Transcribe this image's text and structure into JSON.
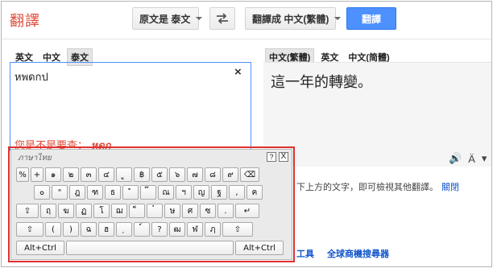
{
  "header": {
    "logo": "翻譯",
    "source_select": "原文是 泰文",
    "target_select": "翻譯成 中文(繁體)",
    "translate_button": "翻譯"
  },
  "source": {
    "tabs": [
      "英文",
      "中文",
      "泰文"
    ],
    "active_tab": 2,
    "text": "หพดกป",
    "clear": "×",
    "did_you_mean_prefix": "您是不是要查：",
    "did_you_mean_suggestion": "หดก"
  },
  "target": {
    "tabs": [
      "中文(繁體)",
      "英文",
      "中文(简體)"
    ],
    "active_tab": 0,
    "text": "這一年的轉變。",
    "speaker": "🔊",
    "phonetic": "Ä",
    "menu": "▾"
  },
  "hint": {
    "text": "下上方的文字，即可檢視其他翻譯。",
    "link": "關閉"
  },
  "footer": {
    "tools": "工具",
    "search_engine": "全球商機搜尋器"
  },
  "keyboard": {
    "title": "ภาษาไทย",
    "help": "?",
    "close": "X",
    "rows": [
      [
        "%",
        "+",
        "๑",
        "๒",
        "๓",
        "๔",
        "ู",
        "฿",
        "๕",
        "๖",
        "๗",
        "๘",
        "๙",
        "⌫"
      ],
      [
        "๐",
        "\"",
        "ฎ",
        "ฑ",
        "ธ",
        "ํ",
        "๊",
        "ณ",
        "ฯ",
        "ญ",
        "ฐ",
        ",",
        "ฅ"
      ],
      [
        "⇪",
        "ฤ",
        "ฆ",
        "ฏ",
        "โ",
        "ฌ",
        "็",
        "๋",
        "ษ",
        "ศ",
        "ซ",
        ".",
        "↵"
      ],
      [
        "⇧",
        "(",
        ")",
        "ฉ",
        "ฮ",
        "ฺ",
        "์",
        "?",
        "ฒ",
        "ฬ",
        "ฦ",
        "⇧"
      ],
      [
        "Alt+Ctrl",
        "",
        "Alt+Ctrl"
      ]
    ]
  }
}
